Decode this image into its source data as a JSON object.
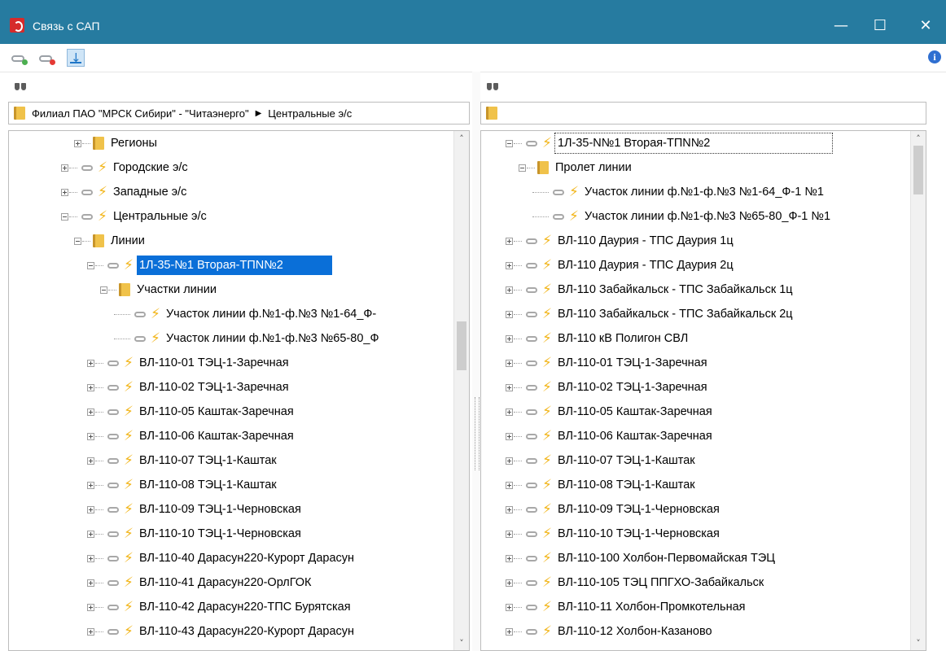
{
  "window": {
    "title": "Связь с САП",
    "controls": {
      "minimize": "—",
      "maximize": "☐",
      "close": "✕"
    }
  },
  "toolbar": {
    "buttons": [
      {
        "name": "link-add",
        "icon": "chain-link-plus-icon",
        "badge_color": "#4caf50"
      },
      {
        "name": "link-remove",
        "icon": "chain-link-remove-icon",
        "badge_color": "#e53935"
      },
      {
        "name": "import",
        "icon": "download-arrow-icon"
      }
    ],
    "info_icon": "i"
  },
  "left": {
    "breadcrumb": [
      "Филиал ПАО \"МРСК Сибири\" - \"Читаэнерго\"",
      "Центральные э/с"
    ],
    "tree": [
      {
        "text": "Регионы",
        "level": 5,
        "type": "folder",
        "expander": "plus"
      },
      {
        "text": "Городские э/с",
        "level": 4,
        "type": "line",
        "expander": "plus"
      },
      {
        "text": "Западные э/с",
        "level": 4,
        "type": "line",
        "expander": "plus"
      },
      {
        "text": "Центральные э/с",
        "level": 4,
        "type": "line",
        "expander": "minus"
      },
      {
        "text": "Линии",
        "level": 5,
        "type": "folder",
        "expander": "minus"
      },
      {
        "text": "1Л-35-№1 Вторая-ТПN№2",
        "level": 6,
        "type": "line",
        "expander": "minus",
        "selected": true
      },
      {
        "text": "Участки линии",
        "level": 7,
        "type": "folder",
        "expander": "minus"
      },
      {
        "text": "Участок линии ф.№1-ф.№3 №1-64_Ф-",
        "level": 8,
        "type": "line",
        "expander": "none"
      },
      {
        "text": "Участок линии ф.№1-ф.№3 №65-80_Ф",
        "level": 8,
        "type": "line",
        "expander": "none"
      },
      {
        "text": "ВЛ-110-01 ТЭЦ-1-Заречная",
        "level": 6,
        "type": "line",
        "expander": "plus"
      },
      {
        "text": "ВЛ-110-02 ТЭЦ-1-Заречная",
        "level": 6,
        "type": "line",
        "expander": "plus"
      },
      {
        "text": "ВЛ-110-05 Каштак-Заречная",
        "level": 6,
        "type": "line",
        "expander": "plus"
      },
      {
        "text": "ВЛ-110-06 Каштак-Заречная",
        "level": 6,
        "type": "line",
        "expander": "plus"
      },
      {
        "text": "ВЛ-110-07 ТЭЦ-1-Каштак",
        "level": 6,
        "type": "line",
        "expander": "plus"
      },
      {
        "text": "ВЛ-110-08 ТЭЦ-1-Каштак",
        "level": 6,
        "type": "line",
        "expander": "plus"
      },
      {
        "text": "ВЛ-110-09 ТЭЦ-1-Черновская",
        "level": 6,
        "type": "line",
        "expander": "plus"
      },
      {
        "text": "ВЛ-110-10 ТЭЦ-1-Черновская",
        "level": 6,
        "type": "line",
        "expander": "plus"
      },
      {
        "text": "ВЛ-110-40 Дарасун220-Курорт Дарасун",
        "level": 6,
        "type": "line",
        "expander": "plus"
      },
      {
        "text": "ВЛ-110-41 Дарасун220-ОрлГОК",
        "level": 6,
        "type": "line",
        "expander": "plus"
      },
      {
        "text": "ВЛ-110-42 Дарасун220-ТПС Бурятская",
        "level": 6,
        "type": "line",
        "expander": "plus"
      },
      {
        "text": "ВЛ-110-43 Дарасун220-Курорт Дарасун",
        "level": 6,
        "type": "line",
        "expander": "plus"
      }
    ]
  },
  "right": {
    "breadcrumb": [],
    "tree": [
      {
        "text": "1Л-35-N№1 Вторая-ТПN№2",
        "level": 1,
        "type": "line",
        "expander": "minus",
        "focused": true
      },
      {
        "text": "Пролет линии",
        "level": 2,
        "type": "folder",
        "expander": "minus"
      },
      {
        "text": "Участок линии ф.№1-ф.№3 №1-64_Ф-1 №1",
        "level": 3,
        "type": "line",
        "expander": "none"
      },
      {
        "text": "Участок линии ф.№1-ф.№3 №65-80_Ф-1 №1",
        "level": 3,
        "type": "line",
        "expander": "none"
      },
      {
        "text": "ВЛ-110 Даурия - ТПС Даурия 1ц",
        "level": 1,
        "type": "line",
        "expander": "plus"
      },
      {
        "text": "ВЛ-110 Даурия - ТПС Даурия 2ц",
        "level": 1,
        "type": "line",
        "expander": "plus"
      },
      {
        "text": "ВЛ-110 Забайкальск - ТПС Забайкальск 1ц",
        "level": 1,
        "type": "line",
        "expander": "plus"
      },
      {
        "text": "ВЛ-110 Забайкальск - ТПС Забайкальск 2ц",
        "level": 1,
        "type": "line",
        "expander": "plus"
      },
      {
        "text": "ВЛ-110 кВ Полигон СВЛ",
        "level": 1,
        "type": "line",
        "expander": "plus"
      },
      {
        "text": "ВЛ-110-01 ТЭЦ-1-Заречная",
        "level": 1,
        "type": "line",
        "expander": "plus"
      },
      {
        "text": "ВЛ-110-02 ТЭЦ-1-Заречная",
        "level": 1,
        "type": "line",
        "expander": "plus"
      },
      {
        "text": "ВЛ-110-05 Каштак-Заречная",
        "level": 1,
        "type": "line",
        "expander": "plus"
      },
      {
        "text": "ВЛ-110-06 Каштак-Заречная",
        "level": 1,
        "type": "line",
        "expander": "plus"
      },
      {
        "text": "ВЛ-110-07 ТЭЦ-1-Каштак",
        "level": 1,
        "type": "line",
        "expander": "plus"
      },
      {
        "text": "ВЛ-110-08 ТЭЦ-1-Каштак",
        "level": 1,
        "type": "line",
        "expander": "plus"
      },
      {
        "text": "ВЛ-110-09 ТЭЦ-1-Черновская",
        "level": 1,
        "type": "line",
        "expander": "plus"
      },
      {
        "text": "ВЛ-110-10 ТЭЦ-1-Черновская",
        "level": 1,
        "type": "line",
        "expander": "plus"
      },
      {
        "text": "ВЛ-110-100 Холбон-Первомайская ТЭЦ",
        "level": 1,
        "type": "line",
        "expander": "plus"
      },
      {
        "text": "ВЛ-110-105 ТЭЦ ППГХО-Забайкальск",
        "level": 1,
        "type": "line",
        "expander": "plus"
      },
      {
        "text": "ВЛ-110-11 Холбон-Промкотельная",
        "level": 1,
        "type": "line",
        "expander": "plus"
      },
      {
        "text": "ВЛ-110-12 Холбон-Казаново",
        "level": 1,
        "type": "line",
        "expander": "plus"
      }
    ]
  },
  "scroll": {
    "left": {
      "position": 0.4,
      "thumb_fraction": 0.1
    },
    "right": {
      "position": 0.0,
      "thumb_fraction": 0.1
    }
  },
  "colors": {
    "titlebar": "#267ba0",
    "selection": "#0a6fd8",
    "folder": "#f0c24a",
    "bolt": "#f2b61c"
  }
}
